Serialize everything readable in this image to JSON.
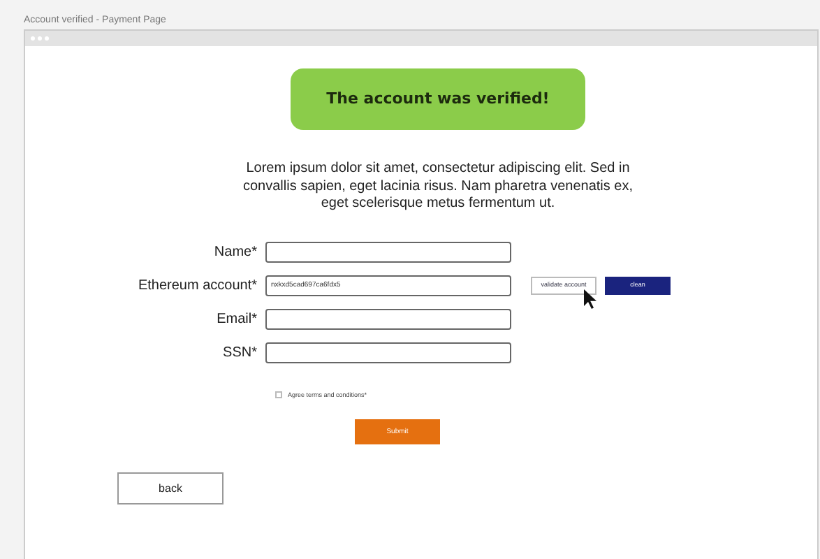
{
  "window": {
    "title": "Account verified - Payment Page"
  },
  "banner": "The account was verified!",
  "description": "Lorem ipsum dolor sit amet, consectetur adipiscing elit. Sed in convallis sapien, eget lacinia risus. Nam pharetra venenatis ex, eget  scelerisque metus fermentum ut.",
  "fields": [
    {
      "label": "Name*"
    },
    {
      "label": "Ethereum account*",
      "value": "nxkxd5cad697ca6fdx5"
    },
    {
      "label": "Email*"
    },
    {
      "label": "SSN*"
    }
  ],
  "account_buttons": [
    "validate account",
    "clean"
  ],
  "terms": {
    "label": "Agree terms and conditions*",
    "checked": false
  },
  "submit": "Submit",
  "back": "back"
}
